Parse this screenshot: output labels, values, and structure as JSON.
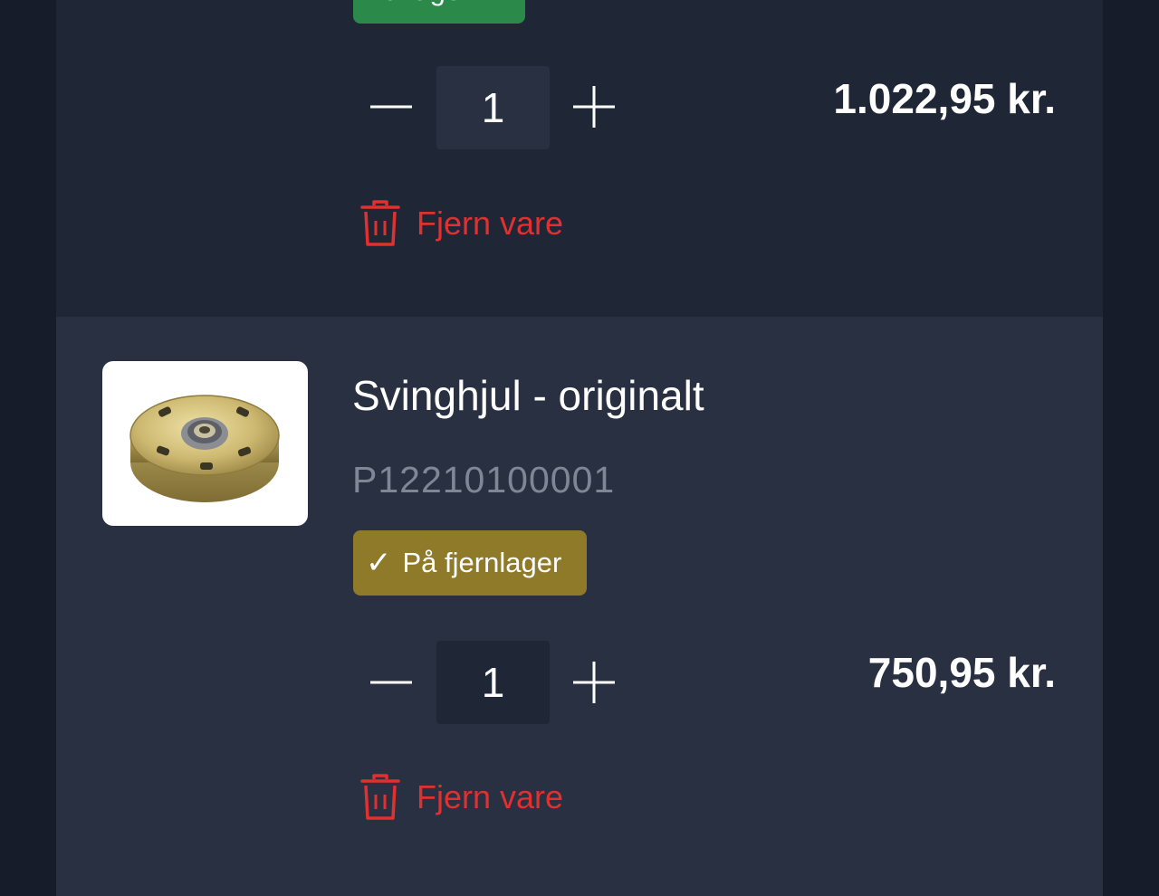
{
  "cart": {
    "items": [
      {
        "stock_badge": {
          "label": "På lager",
          "color": "#2b8a49"
        },
        "quantity": "1",
        "price": "1.022,95 kr.",
        "remove_label": "Fjern vare"
      },
      {
        "title": "Svinghjul - originalt",
        "sku": "P12210100001",
        "image_alt": "flywheel-product-image",
        "stock_badge": {
          "check": "✓",
          "label": "På fjernlager",
          "color": "#8f7a2a"
        },
        "quantity": "1",
        "price": "750,95 kr.",
        "remove_label": "Fjern vare"
      }
    ],
    "icons": {
      "decrease": "minus-icon",
      "increase": "plus-icon",
      "remove": "trash-icon",
      "stock": "check-icon"
    },
    "colors": {
      "page_bg": "#161c29",
      "item_bg_1": "#1f2737",
      "item_bg_2": "#283041",
      "remove_red": "#e0312f",
      "sku_gray": "#7f8796"
    }
  }
}
